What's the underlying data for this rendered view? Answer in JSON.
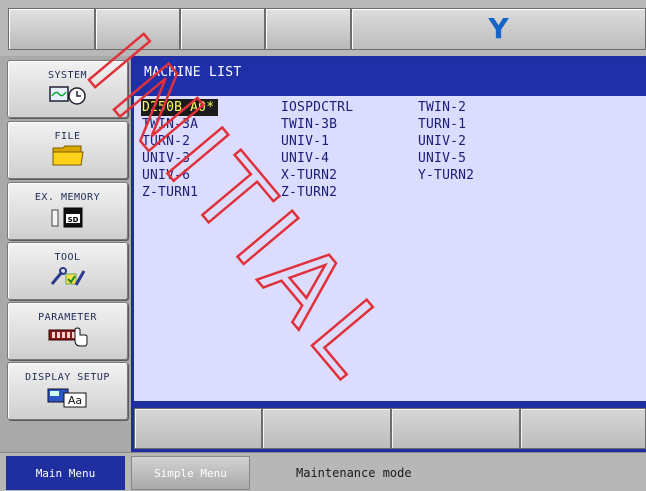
{
  "header": {
    "logo_text": "Y",
    "logo_color": "#1565c8"
  },
  "sidebar": {
    "items": [
      {
        "label": "SYSTEM",
        "icon": "system-icon"
      },
      {
        "label": "FILE",
        "icon": "folder-icon"
      },
      {
        "label": "EX. MEMORY",
        "icon": "sd-card-icon"
      },
      {
        "label": "TOOL",
        "icon": "tool-icon"
      },
      {
        "label": "PARAMETER",
        "icon": "parameter-icon"
      },
      {
        "label": "DISPLAY SETUP",
        "icon": "display-setup-icon"
      }
    ]
  },
  "main": {
    "title": "MACHINE LIST",
    "machines": [
      "D250B-A0*",
      "IOSPDCTRL",
      "TWIN-2",
      "TWIN-3A",
      "TWIN-3B",
      "TURN-1",
      "TURN-2",
      "UNIV-1",
      "UNIV-2",
      "UNIV-3",
      "UNIV-4",
      "UNIV-5",
      "UNIV-6",
      "X-TURN2",
      "Y-TURN2",
      "Z-TURN1",
      "Z-TURN2"
    ],
    "selected_machine": "D250B-A0*"
  },
  "statusbar": {
    "main_menu": "Main Menu",
    "simple_menu": "Simple Menu",
    "mode_message": "Maintenance mode"
  },
  "watermark": {
    "text": "INITIAL",
    "color": "#e0303a"
  }
}
